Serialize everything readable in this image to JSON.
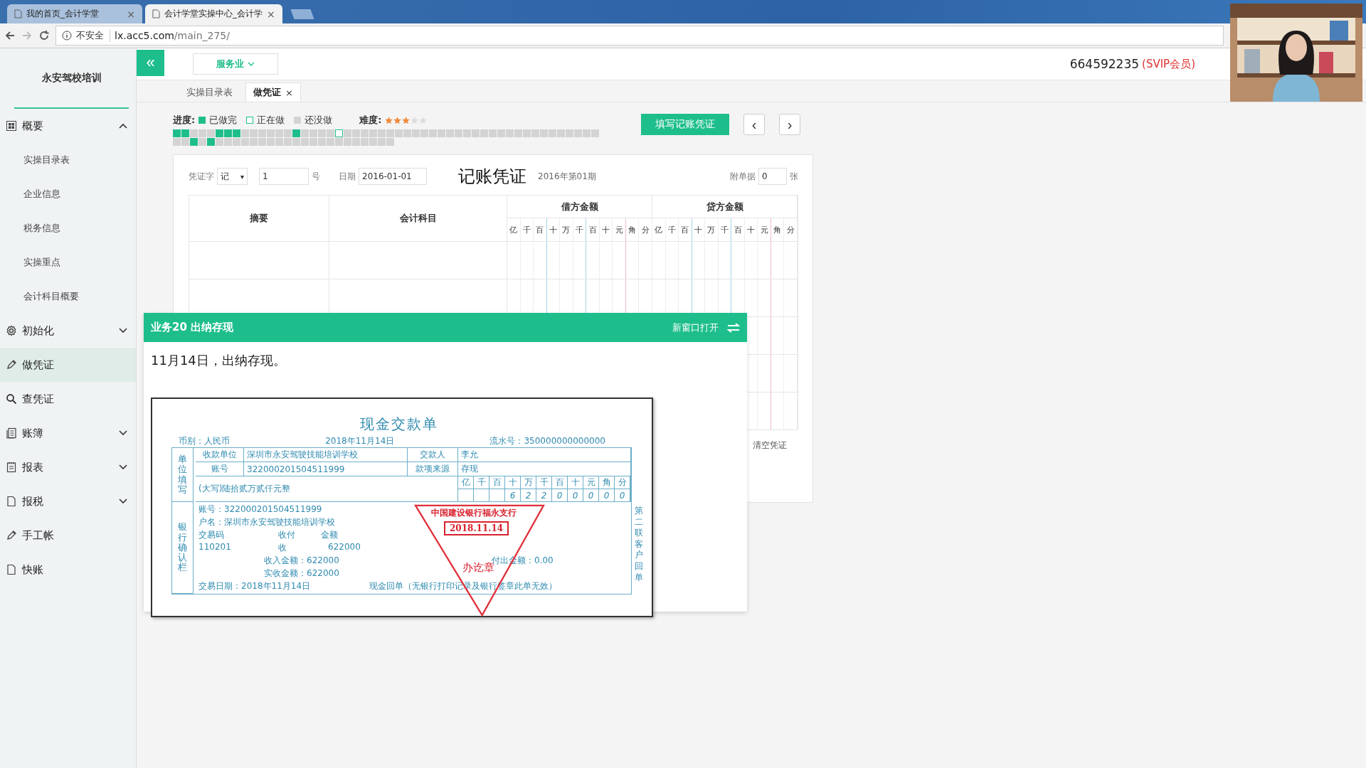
{
  "browser": {
    "tabs": [
      {
        "title": "我的首页_会计学堂",
        "close": "×",
        "selected": false
      },
      {
        "title": "会计学堂实操中心_会计学",
        "close": "×",
        "selected": true
      }
    ],
    "security": "不安全",
    "url_host": "lx.acc5.com",
    "url_path": "/main_275/"
  },
  "sidebar": {
    "title": "永安驾校培训",
    "items": [
      {
        "kind": "group",
        "label": "概要",
        "expanded": true,
        "selected": false,
        "children": [
          {
            "label": "实操目录表"
          },
          {
            "label": "企业信息"
          },
          {
            "label": "税务信息"
          },
          {
            "label": "实操重点"
          },
          {
            "label": "会计科目概要"
          }
        ]
      },
      {
        "kind": "group",
        "label": "初始化",
        "expanded": false,
        "selected": false
      },
      {
        "kind": "link",
        "label": "做凭证",
        "selected": true
      },
      {
        "kind": "link",
        "label": "查凭证",
        "selected": false
      },
      {
        "kind": "group",
        "label": "账簿",
        "expanded": false,
        "selected": false
      },
      {
        "kind": "group",
        "label": "报表",
        "expanded": false,
        "selected": false
      },
      {
        "kind": "group",
        "label": "报税",
        "expanded": false,
        "selected": false
      },
      {
        "kind": "link",
        "label": "手工帐",
        "selected": false
      },
      {
        "kind": "link",
        "label": "快账",
        "selected": false
      }
    ]
  },
  "topbar": {
    "collapse": "«",
    "industry": "服务业",
    "account": "664592235",
    "member": "(SVIP会员)"
  },
  "tabs": [
    {
      "label": "实操目录表",
      "selected": false
    },
    {
      "label": "做凭证",
      "close": "×",
      "selected": true
    }
  ],
  "progress": {
    "label": "进度:",
    "legend": [
      {
        "kind": "done",
        "label": "已做完"
      },
      {
        "kind": "now",
        "label": "正在做"
      },
      {
        "kind": "todo",
        "label": "还没做"
      }
    ],
    "difficulty_label": "难度:",
    "stars": 3,
    "cells": [
      {
        "kind": "done"
      },
      {
        "kind": "done"
      },
      {
        "kind": "todo"
      },
      {
        "kind": "todo"
      },
      {
        "kind": "todo"
      },
      {
        "kind": "done"
      },
      {
        "kind": "done"
      },
      {
        "kind": "done"
      },
      {
        "kind": "todo"
      },
      {
        "kind": "todo"
      },
      {
        "kind": "todo"
      },
      {
        "kind": "todo"
      },
      {
        "kind": "todo"
      },
      {
        "kind": "todo"
      },
      {
        "kind": "done"
      },
      {
        "kind": "todo"
      },
      {
        "kind": "todo"
      },
      {
        "kind": "todo"
      },
      {
        "kind": "todo"
      },
      {
        "kind": "now"
      },
      {
        "kind": "todo"
      },
      {
        "kind": "todo"
      },
      {
        "kind": "todo"
      },
      {
        "kind": "todo"
      },
      {
        "kind": "todo"
      },
      {
        "kind": "todo"
      },
      {
        "kind": "todo"
      },
      {
        "kind": "todo"
      },
      {
        "kind": "todo"
      },
      {
        "kind": "todo"
      },
      {
        "kind": "todo"
      },
      {
        "kind": "todo"
      },
      {
        "kind": "todo"
      },
      {
        "kind": "todo"
      },
      {
        "kind": "todo"
      },
      {
        "kind": "todo"
      },
      {
        "kind": "todo"
      },
      {
        "kind": "todo"
      },
      {
        "kind": "todo"
      },
      {
        "kind": "todo"
      },
      {
        "kind": "todo"
      },
      {
        "kind": "todo"
      },
      {
        "kind": "todo"
      },
      {
        "kind": "todo"
      },
      {
        "kind": "todo"
      },
      {
        "kind": "todo"
      },
      {
        "kind": "todo"
      },
      {
        "kind": "todo"
      },
      {
        "kind": "todo"
      },
      {
        "kind": "todo"
      },
      {
        "kind": "todo"
      },
      {
        "kind": "todo"
      },
      {
        "kind": "done"
      },
      {
        "kind": "todo"
      },
      {
        "kind": "done"
      },
      {
        "kind": "todo"
      },
      {
        "kind": "todo"
      },
      {
        "kind": "todo"
      },
      {
        "kind": "todo"
      },
      {
        "kind": "todo"
      },
      {
        "kind": "todo"
      },
      {
        "kind": "todo"
      },
      {
        "kind": "todo"
      },
      {
        "kind": "todo"
      },
      {
        "kind": "todo"
      },
      {
        "kind": "todo"
      },
      {
        "kind": "todo"
      },
      {
        "kind": "todo"
      },
      {
        "kind": "todo"
      },
      {
        "kind": "todo"
      },
      {
        "kind": "todo"
      },
      {
        "kind": "todo"
      },
      {
        "kind": "todo"
      },
      {
        "kind": "todo"
      },
      {
        "kind": "todo"
      },
      {
        "kind": "todo"
      }
    ]
  },
  "fill_button": "填写记账凭证",
  "prev": "‹",
  "next": "›",
  "voucher": {
    "type_label": "凭证字",
    "type_value": "记",
    "type_caret": "▾",
    "number": "1",
    "number_unit": "号",
    "date_label": "日期",
    "date": "2016-01-01",
    "title": "记账凭证",
    "period": "2016年第01期",
    "attach_label": "附单据",
    "attach": "0",
    "attach_unit": "张",
    "summary_head": "摘要",
    "account_head": "会计科目",
    "debit_head": "借方金额",
    "credit_head": "贷方金额",
    "debit_digits": [
      "亿",
      "千",
      "百",
      "十",
      "万",
      "千",
      "百",
      "十",
      "元",
      "角",
      "分"
    ],
    "credit_digits": [
      "亿",
      "千",
      "百",
      "十",
      "万",
      "千",
      "百",
      "十",
      "元",
      "角",
      "分"
    ],
    "clear_button": "清空凭证"
  },
  "task": {
    "title": "业务20 出纳存现",
    "open_new": "新窗口打开",
    "text": "11月14日，出纳存现。"
  },
  "receipt": {
    "title": "现金交款单",
    "currency": "币别：人民币",
    "date": "2018年11月14日",
    "serial": "流水号：350000000000000",
    "unit_side": "单位填写",
    "payee_label": "收款单位",
    "payee": "深圳市永安驾驶技能培训学校",
    "payer_label": "交款人",
    "payer": "李允",
    "account_label": "账号",
    "account": "322000201504511999",
    "source_label": "款项来源",
    "source": "存现",
    "amount_words": "(大写)陆拾贰万贰仟元整",
    "digits": [
      {
        "head": "亿"
      },
      {
        "head": "千"
      },
      {
        "head": "百"
      },
      {
        "head": "十",
        "value": "6"
      },
      {
        "head": "万",
        "value": "2"
      },
      {
        "head": "千",
        "value": "2"
      },
      {
        "head": "百",
        "value": "0"
      },
      {
        "head": "十",
        "value": "0"
      },
      {
        "head": "元",
        "value": "0"
      },
      {
        "head": "角",
        "value": "0"
      },
      {
        "head": "分",
        "value": "0"
      }
    ],
    "bank_side": "银行确认栏",
    "bank_account": "账号：322000201504511999",
    "bank_name": "户名：深圳市永安驾驶技能培训学校",
    "code_head": "交易码",
    "dir_head": "收付",
    "amount_head": "金额",
    "code": "110201",
    "dir": "收",
    "amount": "622000",
    "income": "收入金额：622000",
    "payout": "付出金额：0.00",
    "received": "实收金额：622000",
    "trade_date": "交易日期：2018年11月14日",
    "note": "现金回单（无银行打印记录及银行签章此单无效）",
    "copy_note": "第二联客户回单",
    "stamp": {
      "bank": "中国建设银行福永支行",
      "date": "2018.11.14",
      "seal": "办讫章"
    }
  }
}
